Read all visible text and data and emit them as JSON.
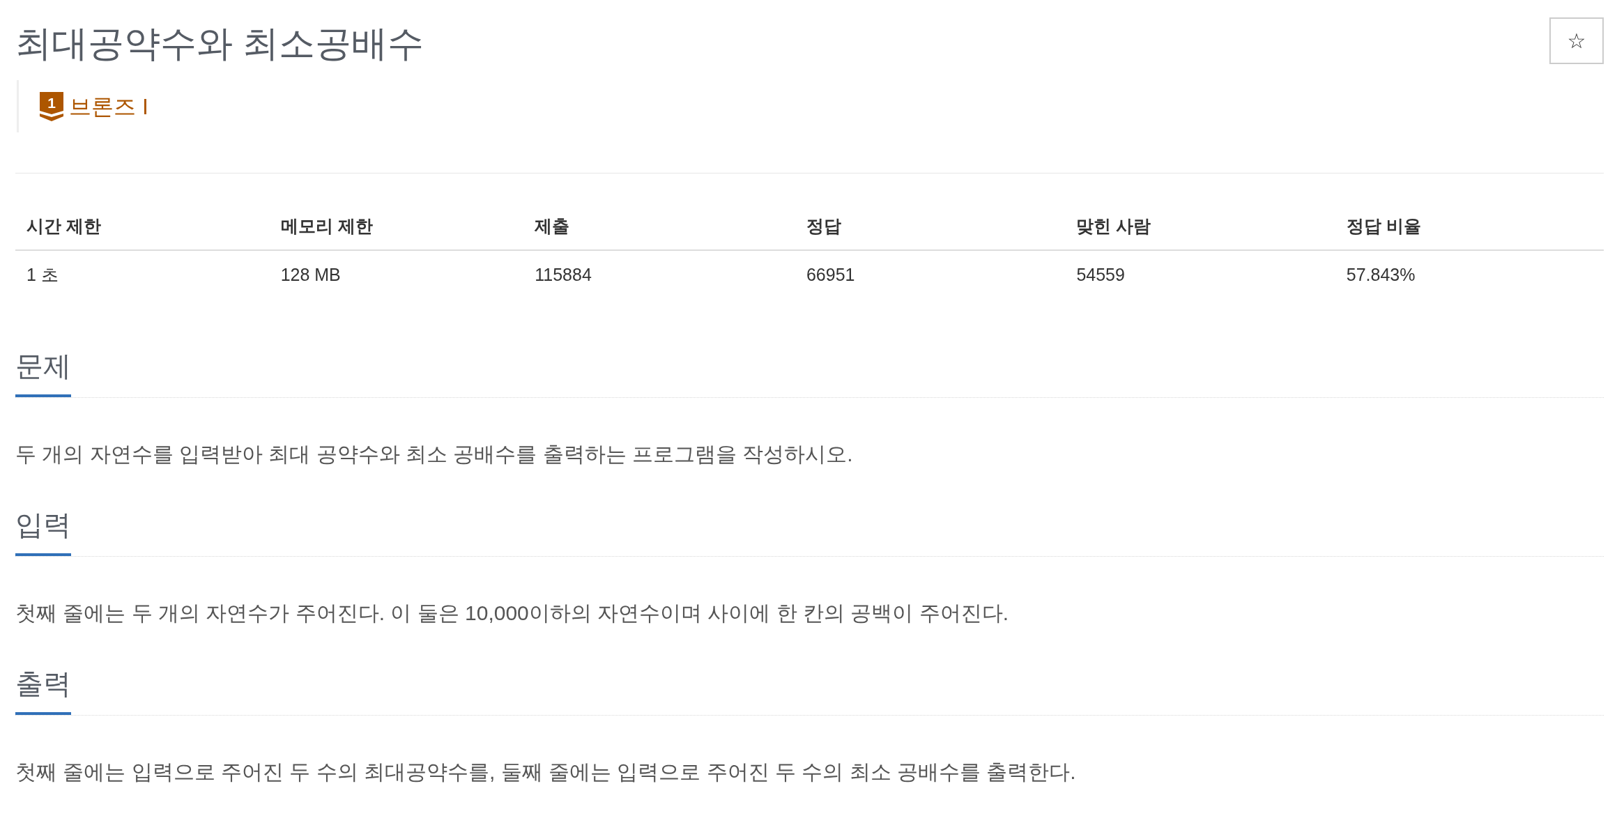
{
  "problem": {
    "title": "최대공약수와 최소공배수",
    "tier": {
      "icon_number": "1",
      "name": "브론즈 I"
    }
  },
  "favorite_button": {
    "symbol": "☆"
  },
  "stats_table": {
    "columns": [
      "시간 제한",
      "메모리 제한",
      "제출",
      "정답",
      "맞힌 사람",
      "정답 비율"
    ],
    "rows": [
      [
        "1 초",
        "128 MB",
        "115884",
        "66951",
        "54559",
        "57.843%"
      ]
    ]
  },
  "sections": [
    {
      "heading": "문제",
      "text": "두 개의 자연수를 입력받아 최대 공약수와 최소 공배수를 출력하는 프로그램을 작성하시오."
    },
    {
      "heading": "입력",
      "text": "첫째 줄에는 두 개의 자연수가 주어진다. 이 둘은 10,000이하의 자연수이며 사이에 한 칸의 공백이 주어진다."
    },
    {
      "heading": "출력",
      "text": "첫째 줄에는 입력으로 주어진 두 수의 최대공약수를, 둘째 줄에는 입력으로 주어진 두 수의 최소 공배수를 출력한다."
    }
  ]
}
